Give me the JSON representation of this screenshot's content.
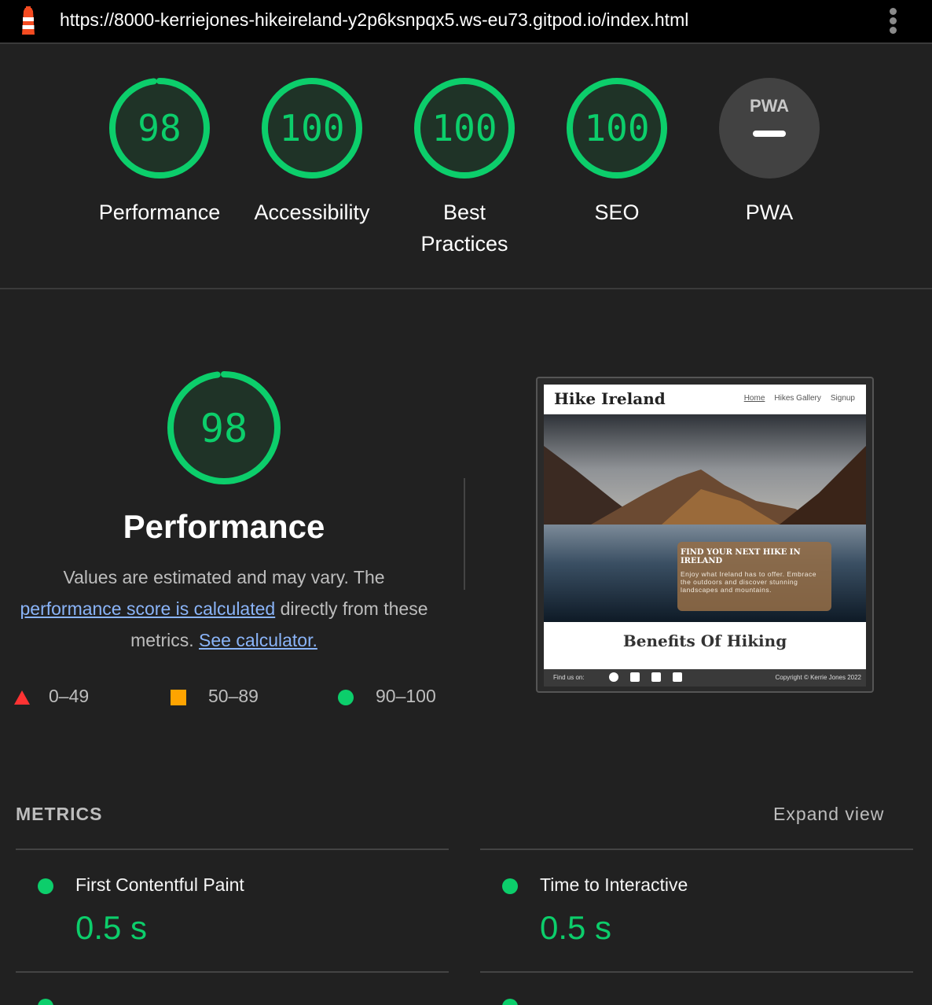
{
  "browser": {
    "url": "https://8000-kerriejones-hikeireland-y2p6ksnpqx5.ws-eu73.gitpod.io/index.html",
    "logo_icon": "lighthouse-icon",
    "menu_icon": "kebab-menu-icon"
  },
  "scores": [
    {
      "label": "Performance",
      "value": "98",
      "fraction": 0.98
    },
    {
      "label": "Accessibility",
      "value": "100",
      "fraction": 1.0
    },
    {
      "label": "Best Practices",
      "value": "100",
      "fraction": 1.0
    },
    {
      "label": "SEO",
      "value": "100",
      "fraction": 1.0
    },
    {
      "label": "PWA",
      "badge_text": "PWA",
      "icon": "pwa-badge-icon"
    }
  ],
  "performance": {
    "score": "98",
    "fraction": 0.98,
    "title": "Performance",
    "desc_before": "Values are estimated and may vary. The ",
    "desc_link": "performance score is calculated",
    "desc_middle": " directly from these metrics. ",
    "calc_link": "See calculator."
  },
  "legend": [
    {
      "range": "0–49",
      "icon": "triangle-fail-icon",
      "color": "#ff3333"
    },
    {
      "range": "50–89",
      "icon": "square-average-icon",
      "color": "#ffa400"
    },
    {
      "range": "90–100",
      "icon": "circle-pass-icon",
      "color": "#0cce6b"
    }
  ],
  "screenshot": {
    "site_title": "Hike Ireland",
    "nav": [
      "Home",
      "Hikes Gallery",
      "Signup"
    ],
    "hero_heading": "FIND YOUR NEXT HIKE IN IRELAND",
    "hero_text": "Enjoy what Ireland has to offer. Embrace the outdoors and discover stunning landscapes and mountains.",
    "section_heading": "Benefits Of Hiking",
    "footer_find": "Find us on:",
    "footer_copy": "Copyright © Kerrie Jones 2022"
  },
  "metrics": {
    "heading": "METRICS",
    "expand": "Expand view",
    "items": [
      {
        "title": "First Contentful Paint",
        "value": "0.5 s"
      },
      {
        "title": "Time to Interactive",
        "value": "0.5 s"
      }
    ]
  },
  "colors": {
    "pass": "#0cce6b",
    "gauge_bg": "#1f3327",
    "background": "#212121"
  }
}
